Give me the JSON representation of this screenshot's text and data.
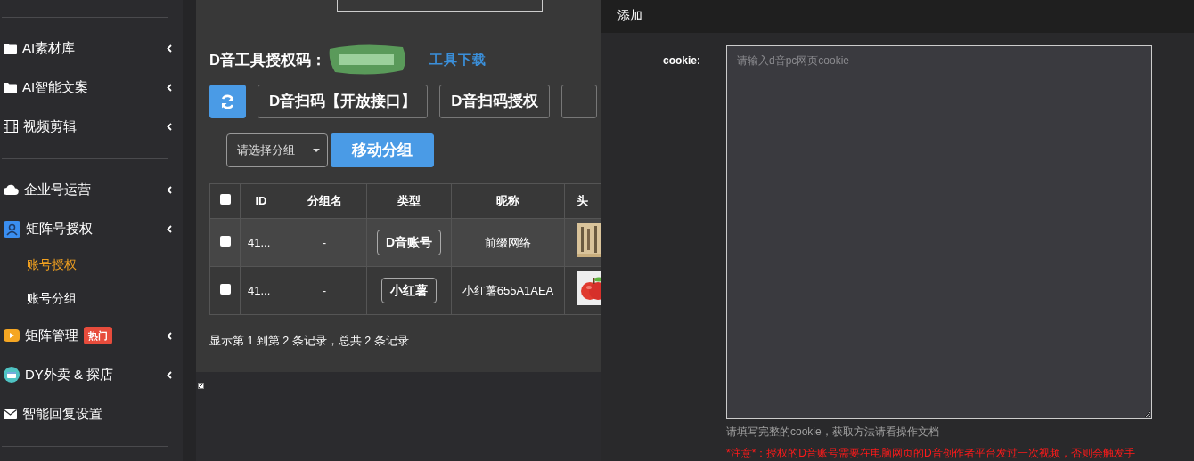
{
  "sidebar": {
    "groups": [
      {
        "items": [
          {
            "label": "AI素材库"
          },
          {
            "label": "AI智能文案"
          },
          {
            "label": "视频剪辑"
          }
        ]
      },
      {
        "items": [
          {
            "label": "企业号运营"
          },
          {
            "label": "矩阵号授权",
            "children": [
              {
                "label": "账号授权",
                "selected": true
              },
              {
                "label": "账号分组",
                "selected": false
              }
            ]
          },
          {
            "label": "矩阵管理",
            "badge": "热门"
          },
          {
            "label": "DY外卖 & 探店"
          },
          {
            "label": "智能回复设置"
          }
        ]
      }
    ]
  },
  "main": {
    "auth_label": "D音工具授权码：",
    "download_link": "工具下载",
    "toolbar_buttons": [
      "D音扫码【开放接口】",
      "D音扫码授权"
    ],
    "group_select": {
      "placeholder": "请选择分组"
    },
    "move_button": "移动分组",
    "table": {
      "header_checked": false,
      "columns": [
        "ID",
        "分组名",
        "类型",
        "昵称",
        "头"
      ],
      "rows": [
        {
          "checked": false,
          "selected": true,
          "id": "41...",
          "group": "-",
          "type": "D音账号",
          "nickname": "前缀网络"
        },
        {
          "checked": false,
          "selected": false,
          "id": "41...",
          "group": "-",
          "type": "小红薯",
          "nickname": "小红薯655A1AEA"
        }
      ]
    },
    "pagination_info": "显示第 1 到第 2 条记录，总共 2 条记录"
  },
  "dialog": {
    "title": "添加",
    "field_label": "cookie:",
    "placeholder": "请输入d音pc网页cookie",
    "help": "请填写完整的cookie，获取方法请看操作文档",
    "note": "*注意*：授权的D音账号需要在电脑网页的D音创作者平台发过一次视频，否则会触发手"
  }
}
